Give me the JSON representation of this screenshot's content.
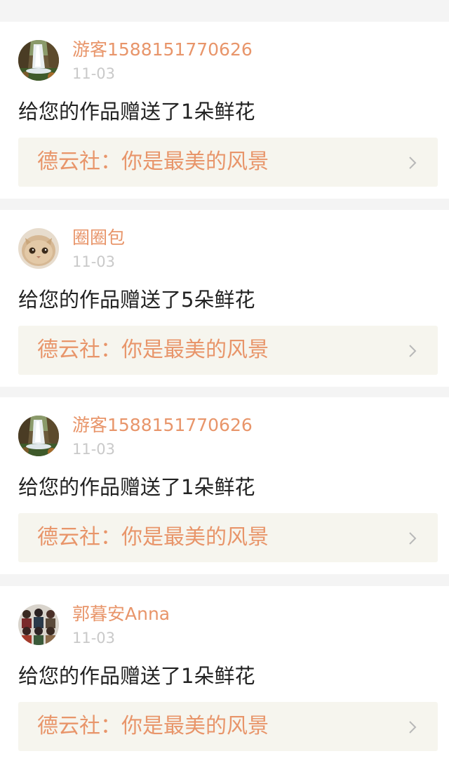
{
  "notifications": [
    {
      "avatar_icon": "waterfall-avatar",
      "username": "游客1588151770626",
      "date": "11-03",
      "message": "给您的作品赠送了1朵鲜花",
      "work_title": "德云社：你是最美的风景"
    },
    {
      "avatar_icon": "kitten-avatar",
      "username": "圈圈包",
      "date": "11-03",
      "message": "给您的作品赠送了5朵鲜花",
      "work_title": "德云社：你是最美的风景"
    },
    {
      "avatar_icon": "waterfall-avatar",
      "username": "游客1588151770626",
      "date": "11-03",
      "message": "给您的作品赠送了1朵鲜花",
      "work_title": "德云社：你是最美的风景"
    },
    {
      "avatar_icon": "group-photo-avatar",
      "username": "郭暮安Anna",
      "date": "11-03",
      "message": "给您的作品赠送了1朵鲜花",
      "work_title": "德云社：你是最美的风景"
    }
  ],
  "colors": {
    "accent": "#e8956a",
    "date": "#c9c9c9",
    "text": "#222222",
    "link_bg": "#f6f5ee",
    "page_bg": "#f4f4f4"
  }
}
